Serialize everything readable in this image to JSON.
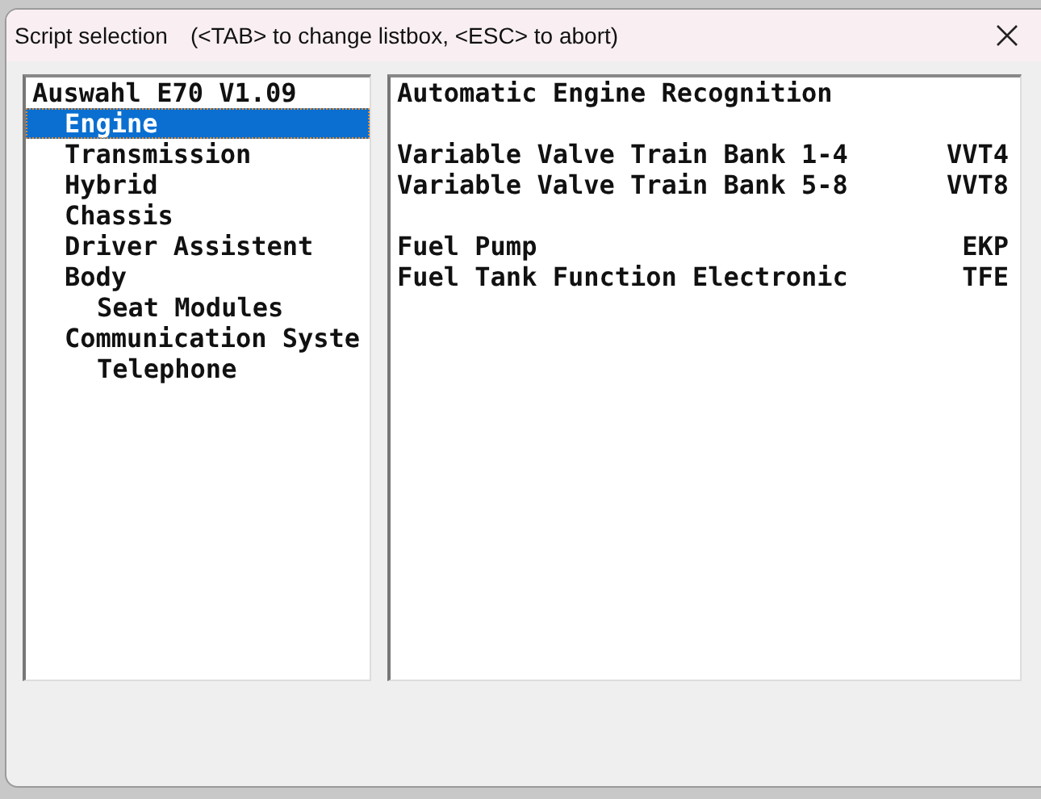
{
  "window": {
    "title": "Script selection",
    "hint": "(<TAB> to change listbox, <ESC> to abort)"
  },
  "tree": {
    "label": "Auswahl E70 V1.09",
    "children": [
      {
        "label": "Engine",
        "selected": true
      },
      {
        "label": "Transmission",
        "selected": false
      },
      {
        "label": "Hybrid",
        "selected": false
      },
      {
        "label": "Chassis",
        "selected": false
      },
      {
        "label": "Driver Assistent",
        "selected": false
      },
      {
        "label": "Body",
        "selected": false,
        "children": [
          {
            "label": "Seat Modules",
            "selected": false
          }
        ]
      },
      {
        "label": "Communication Syste",
        "selected": false,
        "children": [
          {
            "label": "Telephone",
            "selected": false
          }
        ]
      }
    ]
  },
  "scripts": {
    "heading": "Automatic Engine Recognition",
    "groups": [
      [
        {
          "name": "Variable Valve Train Bank 1-4",
          "code": "VVT4"
        },
        {
          "name": "Variable Valve Train Bank 5-8",
          "code": "VVT8"
        }
      ],
      [
        {
          "name": "Fuel Pump",
          "code": "EKP"
        },
        {
          "name": "Fuel Tank Function Electronic",
          "code": "TFE"
        }
      ]
    ]
  }
}
